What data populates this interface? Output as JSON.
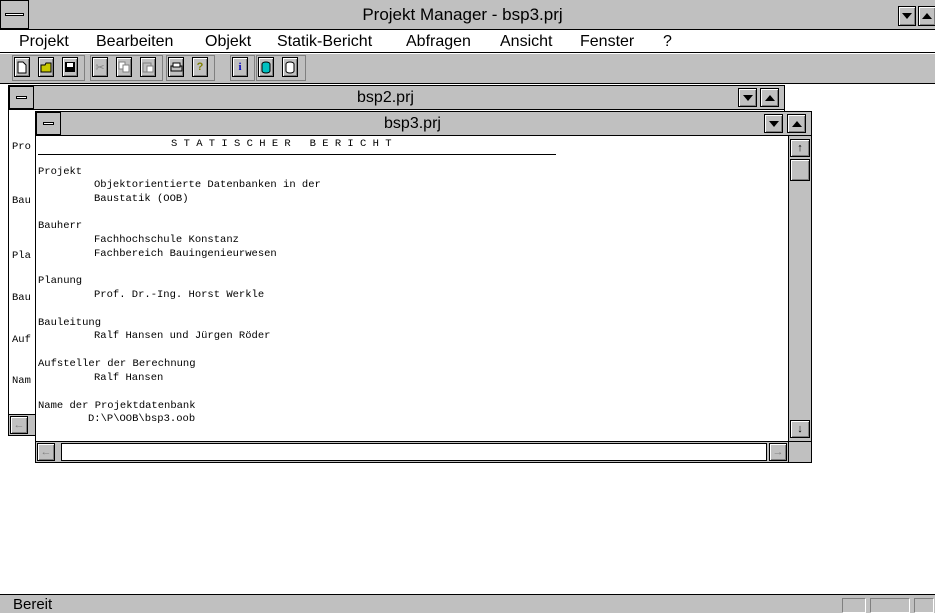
{
  "app": {
    "title": "Projekt Manager - bsp3.prj"
  },
  "menu": {
    "items": [
      "Projekt",
      "Bearbeiten",
      "Objekt",
      "Statik-Bericht",
      "Abfragen",
      "Ansicht",
      "Fenster",
      "?"
    ]
  },
  "toolbar": {
    "icons": [
      "new-file-icon",
      "open-folder-icon",
      "save-icon",
      "cut-icon",
      "copy-icon",
      "paste-icon",
      "print-icon",
      "help-icon",
      "info-icon",
      "database-icon",
      "database-open-icon"
    ]
  },
  "window_back": {
    "title": "bsp2.prj",
    "labels": [
      "Pro",
      "Bau",
      "Pla",
      "Bau",
      "Auf",
      "Nam"
    ]
  },
  "window_front": {
    "title": "bsp3.prj",
    "report_heading": "S T A T I S C H E R   B E R I C H T",
    "sections": [
      {
        "heading": "Projekt",
        "lines": [
          "Objektorientierte Datenbanken in der",
          "Baustatik (OOB)"
        ]
      },
      {
        "heading": "Bauherr",
        "lines": [
          "Fachhochschule Konstanz",
          "Fachbereich Bauingenieurwesen"
        ]
      },
      {
        "heading": "Planung",
        "lines": [
          "Prof. Dr.-Ing. Horst Werkle"
        ]
      },
      {
        "heading": "Bauleitung",
        "lines": [
          "Ralf Hansen und Jürgen Röder"
        ]
      },
      {
        "heading": "Aufsteller der Berechnung",
        "lines": [
          "Ralf Hansen"
        ]
      },
      {
        "heading": "Name der Projektdatenbank",
        "lines": [
          "D:\\P\\OOB\\bsp3.oob"
        ]
      }
    ]
  },
  "status": {
    "text": "Bereit"
  }
}
